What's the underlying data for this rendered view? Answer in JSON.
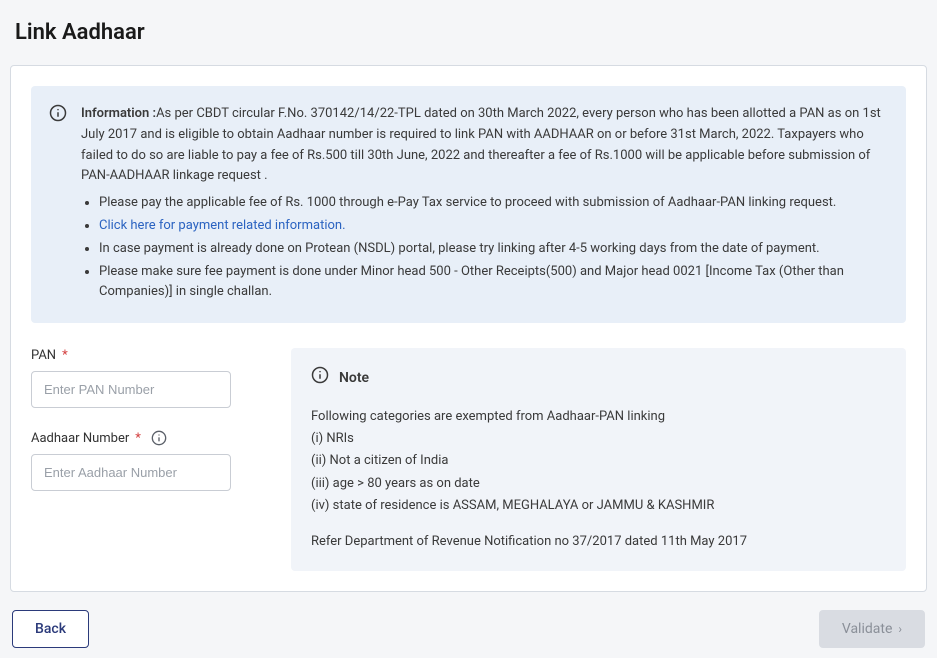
{
  "page": {
    "title": "Link Aadhaar"
  },
  "info": {
    "label": "Information :",
    "lead": "As per CBDT circular F.No. 370142/14/22-TPL dated on 30th March 2022, every person who has been allotted a PAN as on 1st July 2017 and is eligible to obtain Aadhaar number is required to link PAN with AADHAAR on or before 31st March, 2022. Taxpayers who failed to do so are liable to pay a fee of Rs.500 till 30th June, 2022 and thereafter a fee of Rs.1000 will be applicable before submission of PAN-AADHAAR linkage request .",
    "bullets": {
      "b1": "Please pay the applicable fee of Rs. 1000 through e-Pay Tax service to proceed with submission of Aadhaar-PAN linking request.",
      "link": "Click here for payment related information.",
      "b2": "In case payment is already done on Protean (NSDL) portal, please try linking after 4-5 working days from the date of payment.",
      "b3": "Please make sure fee payment is done under Minor head 500 - Other Receipts(500) and Major head 0021 [Income Tax (Other than Companies)] in single challan."
    }
  },
  "form": {
    "pan": {
      "label": "PAN",
      "placeholder": "Enter PAN Number"
    },
    "aadhaar": {
      "label": "Aadhaar Number",
      "placeholder": "Enter Aadhaar Number"
    }
  },
  "note": {
    "title": "Note",
    "body1": "Following categories are exempted from Aadhaar-PAN linking",
    "i": "(i) NRIs",
    "ii": "(ii) Not a citizen of India",
    "iii": "(iii) age > 80 years as on date",
    "iv": "(iv) state of residence is ASSAM, MEGHALAYA or JAMMU & KASHMIR",
    "footer": "Refer Department of Revenue Notification no 37/2017 dated 11th May 2017"
  },
  "actions": {
    "back": "Back",
    "validate": "Validate"
  }
}
